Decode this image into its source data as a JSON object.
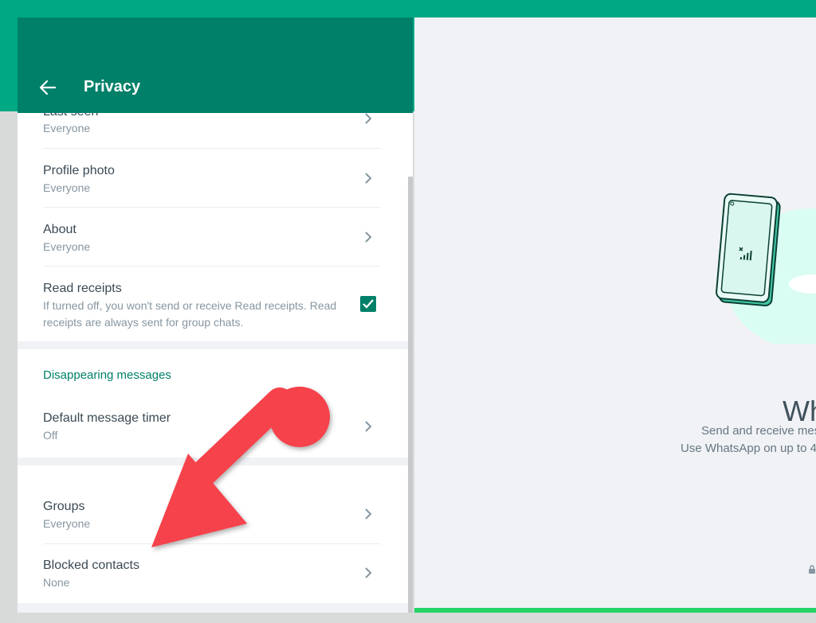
{
  "header": {
    "title": "Privacy"
  },
  "who_can_see": {
    "items": [
      {
        "label": "Last seen",
        "value": "Everyone"
      },
      {
        "label": "Profile photo",
        "value": "Everyone"
      },
      {
        "label": "About",
        "value": "Everyone"
      }
    ]
  },
  "read_receipts": {
    "label": "Read receipts",
    "description": "If turned off, you won't send or receive Read receipts. Read receipts are always sent for group chats.",
    "checked": true
  },
  "disappearing": {
    "heading": "Disappearing messages",
    "timer_label": "Default message timer",
    "timer_value": "Off"
  },
  "other": {
    "items": [
      {
        "label": "Groups",
        "value": "Everyone"
      },
      {
        "label": "Blocked contacts",
        "value": "None"
      }
    ]
  },
  "intro_panel": {
    "title_partial": "Wh",
    "line1_partial": "Send and receive mes",
    "line2_partial": "Use WhatsApp on up to 4"
  },
  "colors": {
    "header": "#008069",
    "top_band": "#00a884",
    "accent": "#008069",
    "arrow": "#f5424b",
    "bottom_bar": "#25d366"
  },
  "icons": {
    "back": "arrow-left-icon",
    "chevron": "chevron-right-icon",
    "check": "checkmark-icon",
    "phone": "phone-illustration",
    "lock": "lock-icon"
  }
}
